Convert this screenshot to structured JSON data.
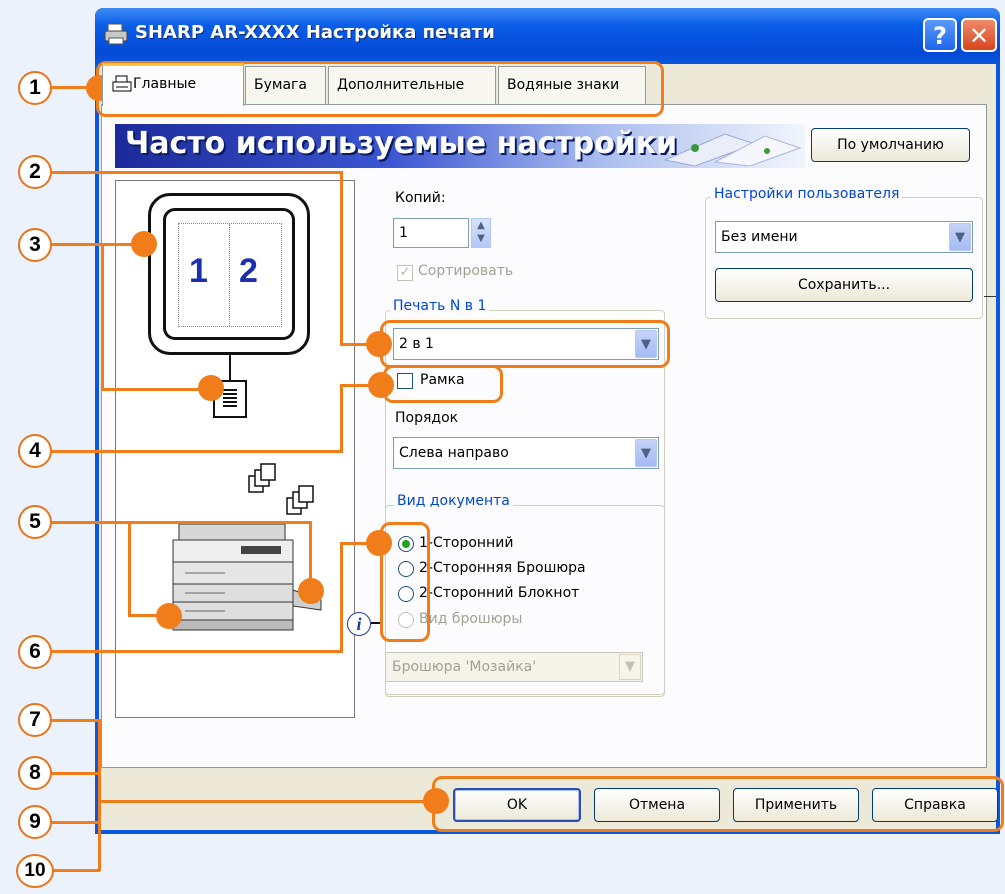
{
  "window": {
    "title": "SHARP AR-XXXX Настройка печати",
    "help_symbol": "?",
    "close_symbol": "✕"
  },
  "tabs": [
    {
      "label": "Главные",
      "active": true
    },
    {
      "label": "Бумага"
    },
    {
      "label": "Дополнительные"
    },
    {
      "label": "Водяные знаки"
    }
  ],
  "banner": {
    "title": "Часто используемые настройки",
    "defaults_button": "По умолчанию"
  },
  "preview": {
    "page_numbers": [
      "1",
      "2"
    ]
  },
  "copies": {
    "label": "Копий:",
    "value": "1",
    "collate_label": "Сортировать",
    "collate_checked": true,
    "collate_enabled": false
  },
  "n_up": {
    "group_label": "Печать N в 1",
    "value": "2 в 1",
    "border_label": "Рамка",
    "border_checked": false,
    "order_label": "Порядок",
    "order_value": "Слева направо"
  },
  "user_settings": {
    "group_label": "Настройки пользователя",
    "value": "Без имени",
    "save_button": "Сохранить..."
  },
  "document_style": {
    "group_label": "Вид документа",
    "options": [
      {
        "label": "1-Сторонний",
        "selected": true,
        "enabled": true
      },
      {
        "label": "2-Сторонняя Брошюра",
        "selected": false,
        "enabled": true
      },
      {
        "label": "2-Сторонний Блокнот",
        "selected": false,
        "enabled": true
      },
      {
        "label": "Вид брошюры",
        "selected": false,
        "enabled": false
      }
    ],
    "booklet_value": "Брошюра 'Мозайка'"
  },
  "buttons": {
    "ok": "OK",
    "cancel": "Отмена",
    "apply": "Применить",
    "help": "Справка"
  },
  "callouts": [
    "1",
    "2",
    "3",
    "4",
    "5",
    "6",
    "7",
    "8",
    "9",
    "10"
  ],
  "colors": {
    "accent_orange": "#f07d1a",
    "titlebar_blue": "#0a58e0",
    "group_title": "#0046d5"
  }
}
